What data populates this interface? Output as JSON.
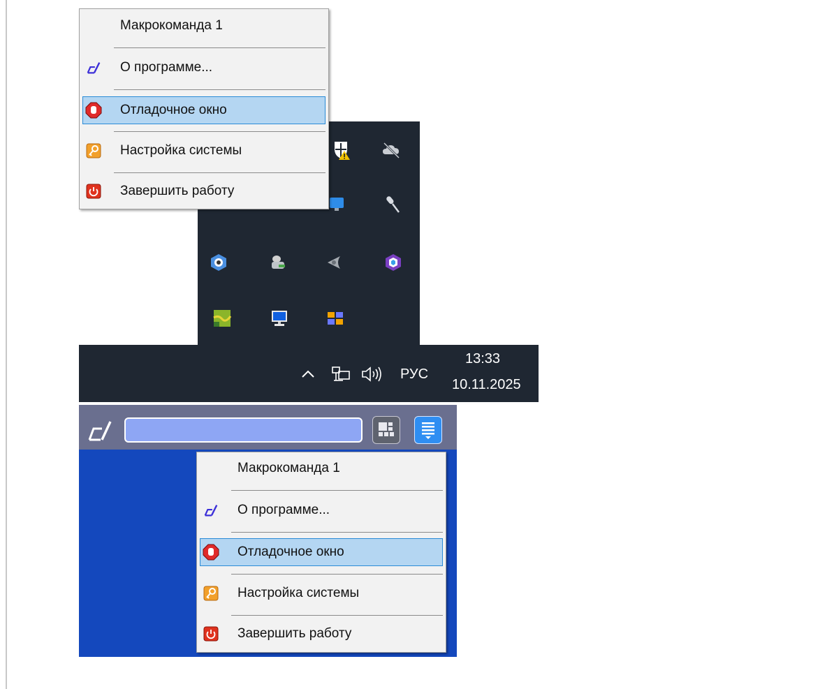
{
  "menu_items": [
    {
      "label": "Макрокоманда 1",
      "icon": ""
    },
    {
      "label": "О программе...",
      "icon": "app-logo-icon"
    },
    {
      "label": "Отладочное окно",
      "icon": "stop-icon",
      "highlighted": true
    },
    {
      "label": "Настройка системы",
      "icon": "key-icon"
    },
    {
      "label": "Завершить работу",
      "icon": "power-icon"
    }
  ],
  "taskbar": {
    "language": "РУС",
    "time": "13:33",
    "date": "10.11.2025"
  },
  "colors": {
    "menu_highlight": "#b4d6f2",
    "menu_highlight_border": "#2a8bd6",
    "taskbar": "#1f2732",
    "appbar": "#6a6f8f",
    "search_field": "#8ea6f4",
    "menu_button": "#2f8ef2",
    "desktop": "#1448bd"
  }
}
